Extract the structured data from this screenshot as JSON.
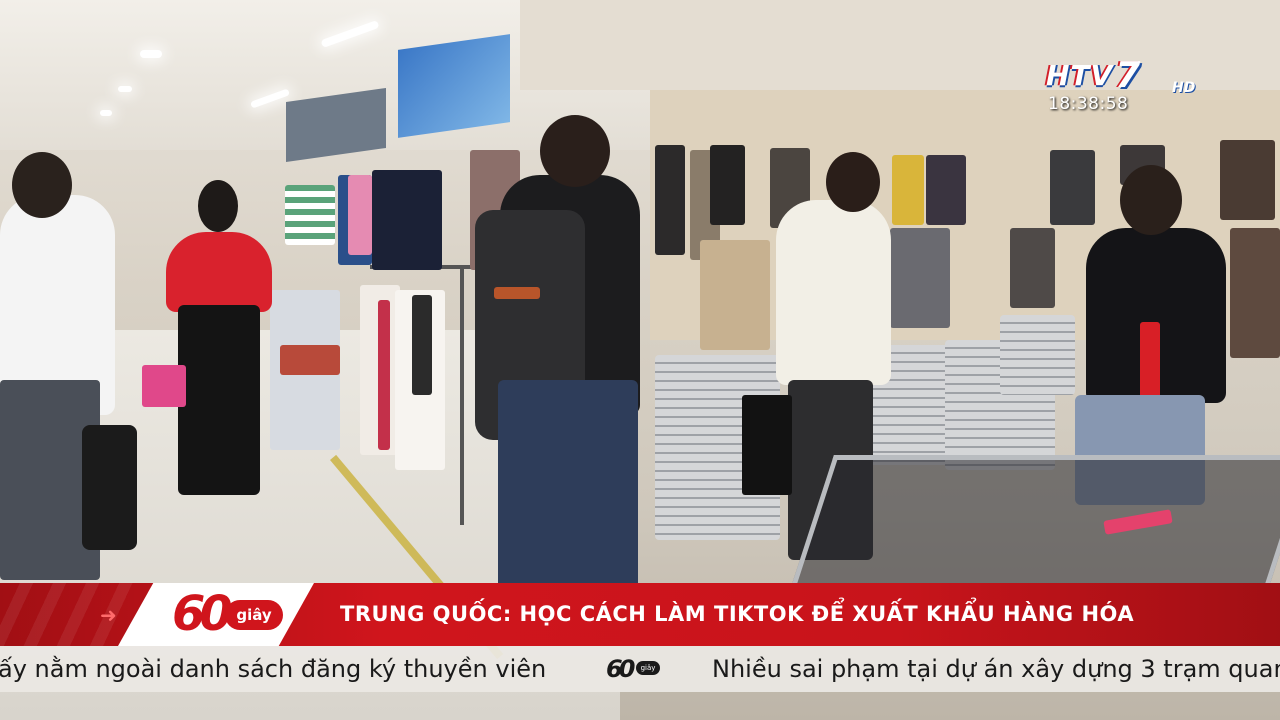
{
  "channel": {
    "name_letters": "HTV",
    "number": "7",
    "suffix": "HD",
    "clock": "18:38:58"
  },
  "program_badge": {
    "number": "60",
    "unit": "giây"
  },
  "headline": "TRUNG QUỐC: HỌC CÁCH LÀM TIKTOK ĐỂ XUẤT KHẨU HÀNG HÓA",
  "ticker": {
    "left_text": "ấy nằm ngoài danh sách đăng ký thuyền viên",
    "separator_number": "60",
    "separator_unit": "giây",
    "right_text": "Nhiều sai phạm tại dự án xây dựng 3 trạm quan"
  },
  "colors": {
    "bar_red": "#d0151c",
    "ticker_bg": "#ebe8e4",
    "logo_red": "#d21f2a",
    "logo_blue": "#1d4fa3"
  }
}
